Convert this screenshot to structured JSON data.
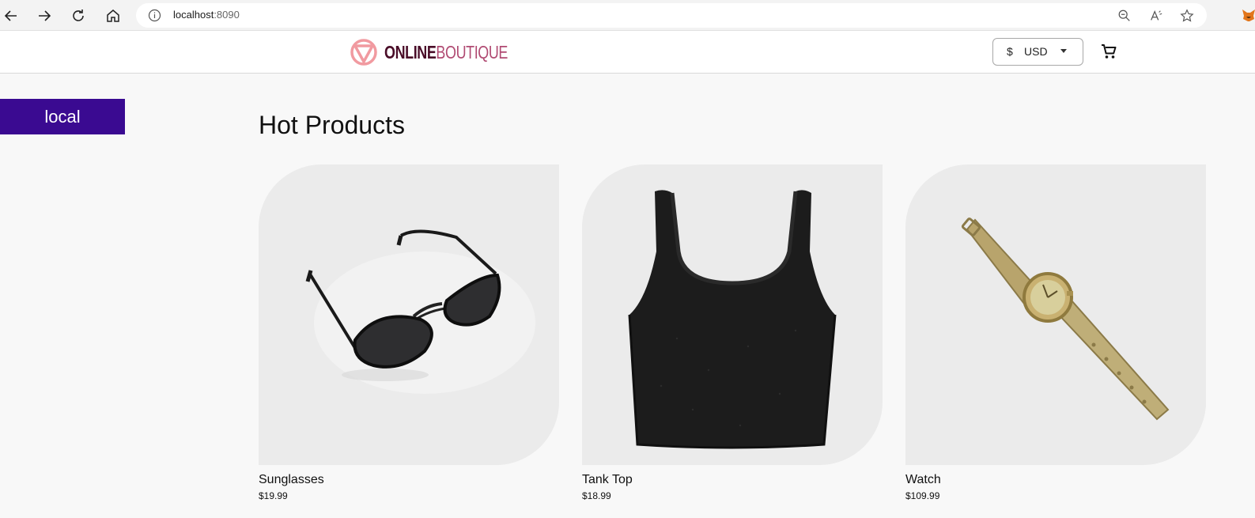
{
  "browser": {
    "url_host": "localhost",
    "url_port": ":8090"
  },
  "header": {
    "logo_online": "ONLINE",
    "logo_boutique": "BOUTIQUE",
    "currency_symbol": "$",
    "currency_code": "USD"
  },
  "env_badge": "local",
  "main": {
    "section_title": "Hot Products",
    "products": [
      {
        "name": "Sunglasses",
        "price": "$19.99",
        "icon": "sunglasses-image"
      },
      {
        "name": "Tank Top",
        "price": "$18.99",
        "icon": "tank-top-image"
      },
      {
        "name": "Watch",
        "price": "$109.99",
        "icon": "watch-image"
      }
    ]
  },
  "colors": {
    "env_badge_bg": "#3a0a91",
    "logo_dark": "#4a0d28",
    "logo_light": "#b04a72",
    "logo_mark": "#f19aa0"
  }
}
